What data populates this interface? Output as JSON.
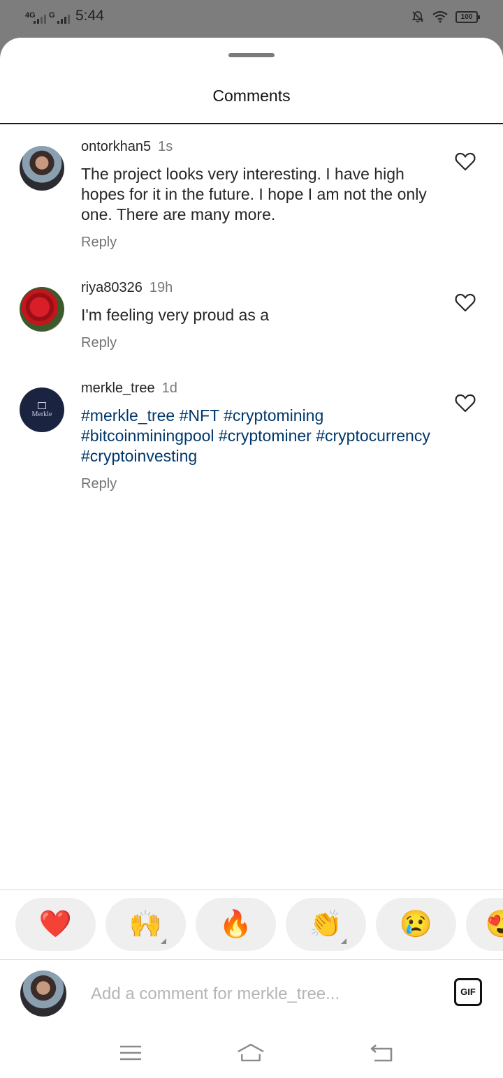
{
  "status_bar": {
    "net1": "4G",
    "net2": "G",
    "time": "5:44",
    "battery": "100"
  },
  "sheet": {
    "title": "Comments"
  },
  "comments": [
    {
      "username": "ontorkhan5",
      "age": "1s",
      "text": "The project looks very interesting. I have high hopes for it in the future. I hope I am not the only one. There are many more.",
      "reply_label": "Reply"
    },
    {
      "username": "riya80326",
      "age": "19h",
      "text": "I'm feeling very proud as a",
      "reply_label": "Reply"
    },
    {
      "username": "merkle_tree",
      "age": "1d",
      "text": "#merkle_tree #NFT #cryptomining #bitcoinminingpool #cryptominer #cryptocurrency #cryptoinvesting",
      "reply_label": "Reply",
      "avatar_text": "Merkle"
    }
  ],
  "quick_emojis": [
    "❤️",
    "🙌",
    "🔥",
    "👏",
    "😢",
    "😍"
  ],
  "composer": {
    "placeholder": "Add a comment for merkle_tree...",
    "value": "",
    "gif_label": "GIF"
  },
  "accent_colors": {
    "hashtag": "#00376b",
    "meta_text": "#737373"
  },
  "icons": {
    "like": "heart-outline-icon",
    "nav": [
      "menu-icon",
      "home-icon",
      "back-icon"
    ]
  }
}
